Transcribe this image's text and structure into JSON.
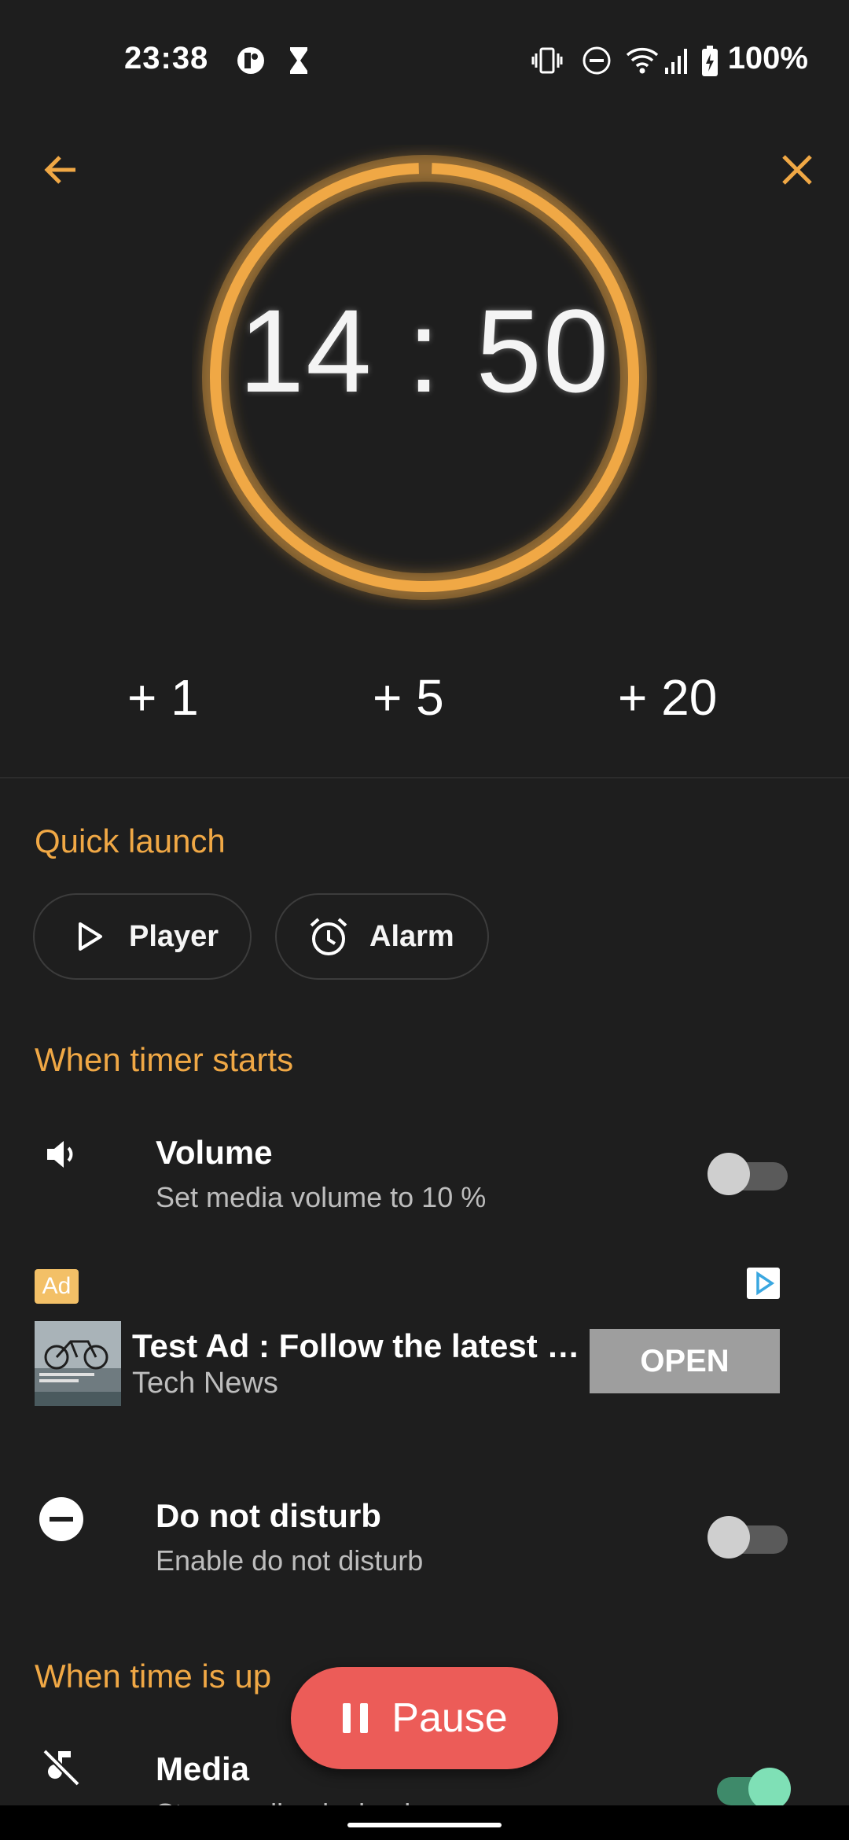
{
  "status_bar": {
    "time": "23:38",
    "battery_percent": "100%",
    "icons": [
      "app-icon",
      "hourglass-icon",
      "vibrate-icon",
      "do-not-disturb-icon",
      "wifi-icon",
      "signal-icon",
      "battery-charging-icon"
    ]
  },
  "header": {
    "back_icon": "arrow-left-icon",
    "close_icon": "close-icon"
  },
  "timer": {
    "display": "14 : 50",
    "progress_fraction": 0.99,
    "ring_color": "#f0a845"
  },
  "add_time": [
    "+ 1",
    "+ 5",
    "+ 20"
  ],
  "quick_launch": {
    "title": "Quick launch",
    "chips": [
      {
        "label": "Player",
        "icon": "play-icon"
      },
      {
        "label": "Alarm",
        "icon": "alarm-clock-icon"
      }
    ]
  },
  "when_starts": {
    "title": "When timer starts",
    "volume": {
      "title": "Volume",
      "subtitle": "Set media volume to 10 %",
      "enabled": false
    },
    "dnd": {
      "title": "Do not disturb",
      "subtitle": "Enable do not disturb",
      "enabled": false
    }
  },
  "ad": {
    "badge": "Ad",
    "title": "Test Ad : Follow the latest …",
    "source": "Tech News",
    "cta": "OPEN"
  },
  "when_up": {
    "title": "When time is up",
    "media": {
      "title": "Media",
      "subtitle": "Stop media playback",
      "enabled": true
    }
  },
  "fab": {
    "label": "Pause",
    "icon": "pause-icon"
  },
  "colors": {
    "accent": "#f0a845",
    "fab": "#ec5c58",
    "background": "#1e1e1e"
  }
}
